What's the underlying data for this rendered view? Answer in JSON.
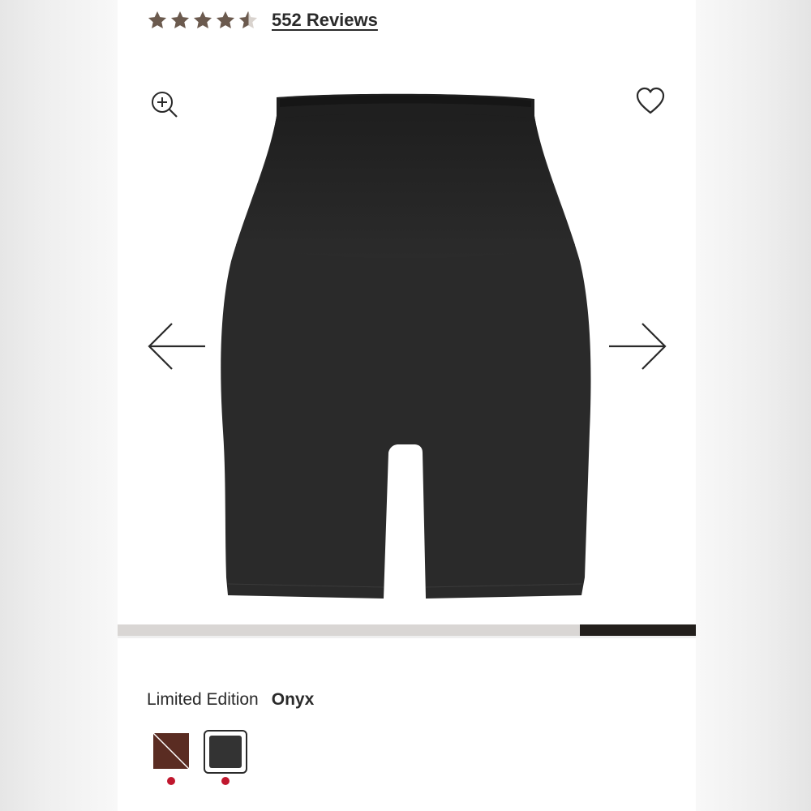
{
  "rating": {
    "stars": 4.5,
    "max_stars": 5,
    "reviews_label": "552 Reviews"
  },
  "icons": {
    "zoom": "zoom-in-icon",
    "wishlist": "heart-icon",
    "prev": "arrow-left-icon",
    "next": "arrow-right-icon"
  },
  "gallery": {
    "product_image": "black high-waisted mid-thigh shorts",
    "progress_fraction": 0.2,
    "progress_position": "end"
  },
  "color": {
    "label": "Limited Edition",
    "value": "Onyx",
    "swatches": [
      {
        "name": "cocoa",
        "color": "#5a2c22",
        "selected": false,
        "indicator": "red-dot"
      },
      {
        "name": "onyx",
        "color": "#333333",
        "selected": true,
        "indicator": "red-dot"
      }
    ]
  },
  "colors": {
    "star": "#6b5a4e",
    "text": "#2a2a2a",
    "progress_track": "#d9d6d4",
    "progress_fill": "#231f1c",
    "indicator_dot": "#c0172e"
  }
}
